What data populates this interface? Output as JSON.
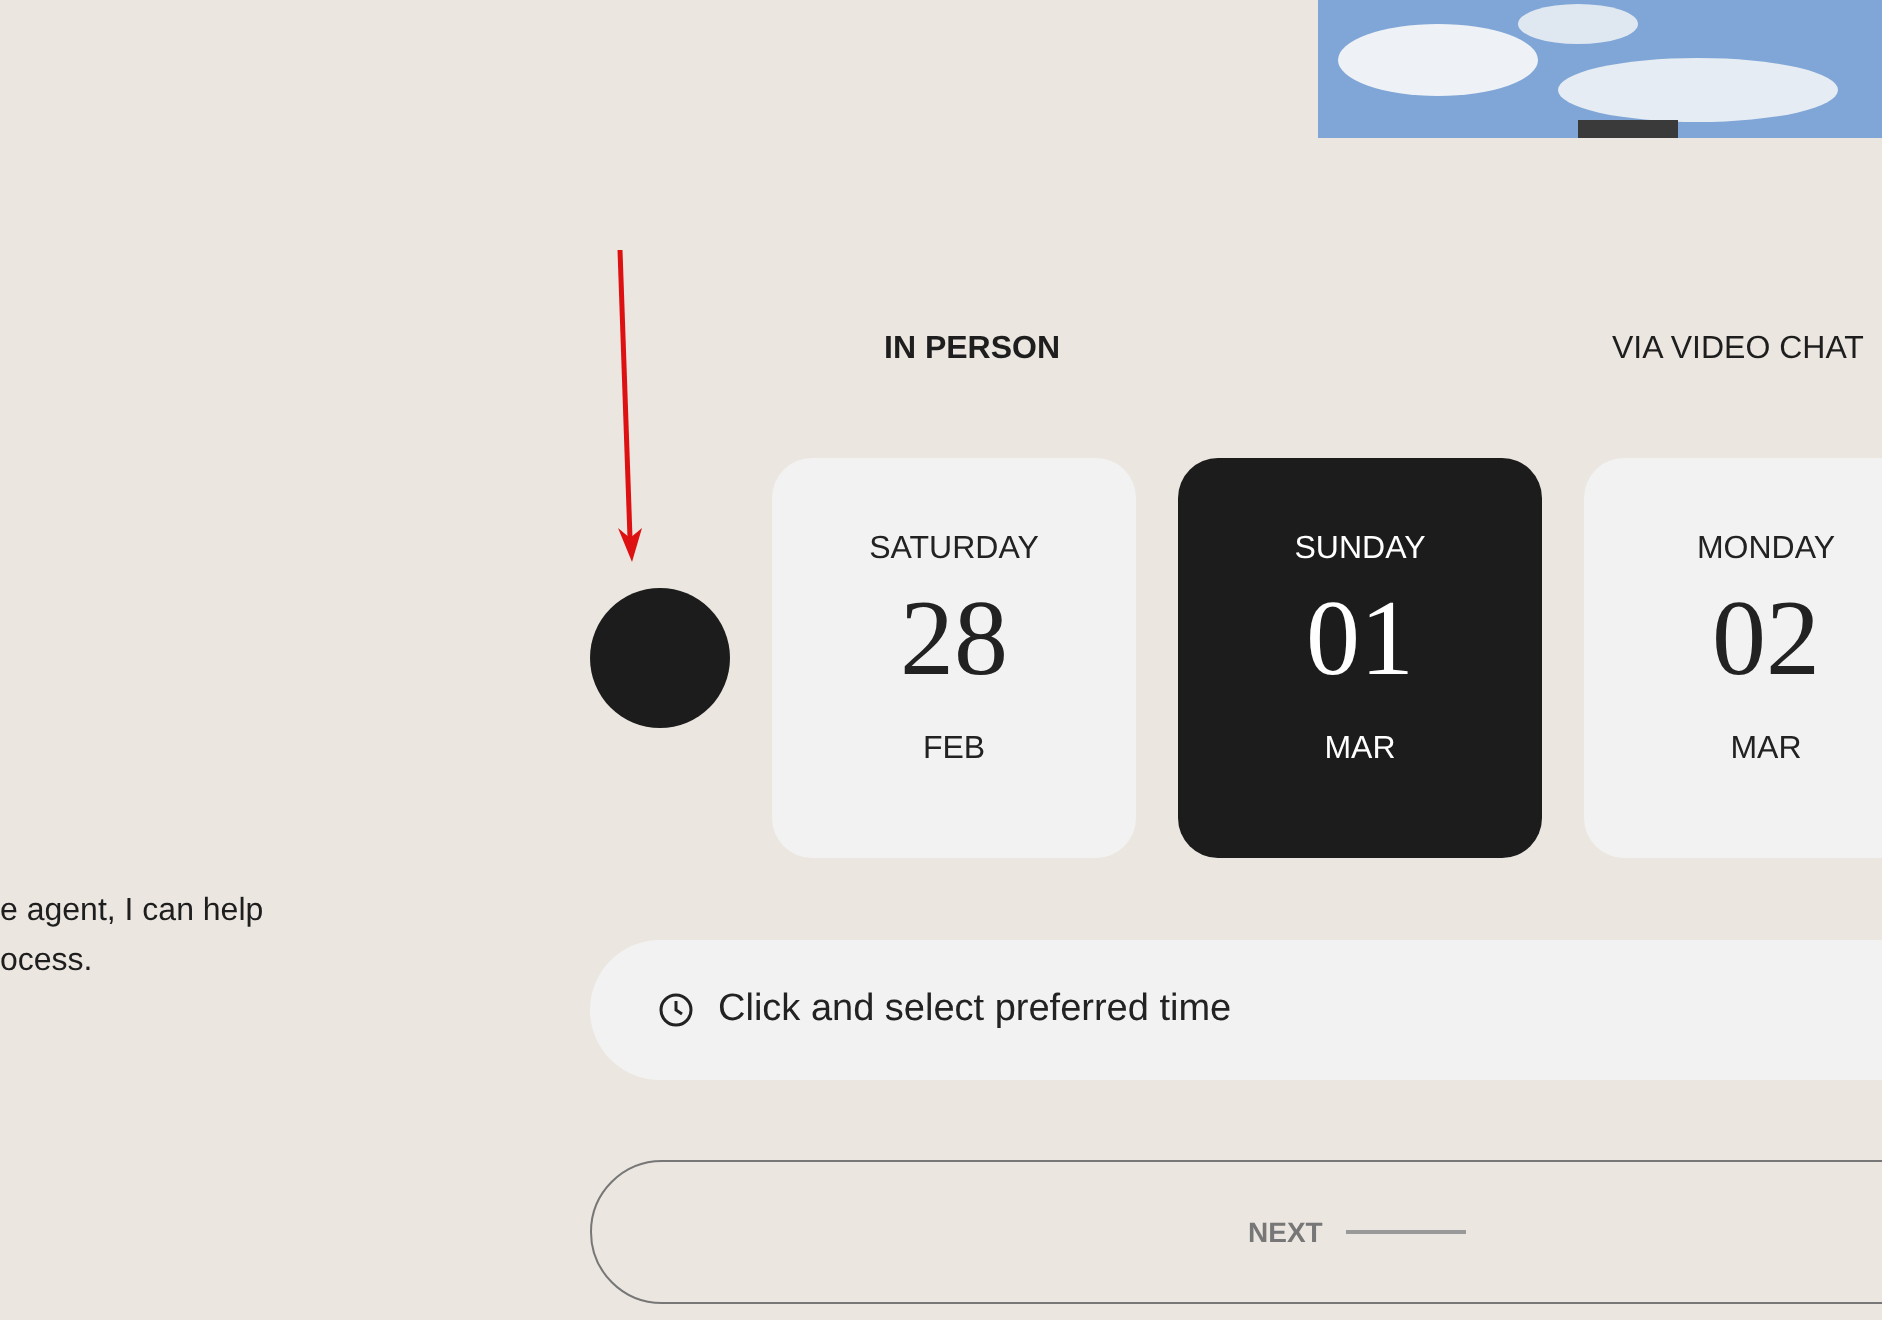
{
  "intro_text": [
    "e agent, I can help",
    "ocess."
  ],
  "modes": [
    {
      "label": "IN PERSON",
      "selected": true
    },
    {
      "label": "VIA VIDEO CHAT",
      "selected": false
    }
  ],
  "dates": [
    {
      "weekday": "SATURDAY",
      "day": "28",
      "month": "FEB",
      "selected": false
    },
    {
      "weekday": "SUNDAY",
      "day": "01",
      "month": "MAR",
      "selected": true
    },
    {
      "weekday": "MONDAY",
      "day": "02",
      "month": "MAR",
      "selected": false
    }
  ],
  "time_field": {
    "placeholder": "Click and select preferred time"
  },
  "next_button": {
    "label": "NEXT"
  }
}
